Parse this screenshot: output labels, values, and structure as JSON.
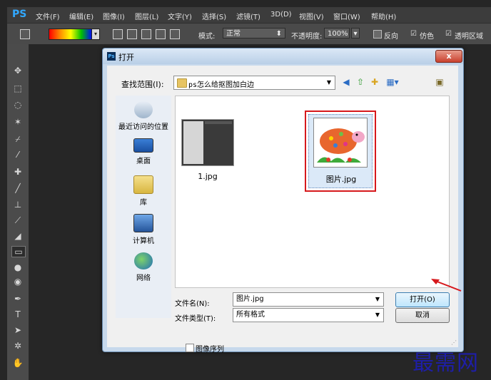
{
  "app": {
    "logo": "PS",
    "menu": [
      "文件(F)",
      "编辑(E)",
      "图像(I)",
      "图层(L)",
      "文字(Y)",
      "选择(S)",
      "滤镜(T)",
      "3D(D)",
      "视图(V)",
      "窗口(W)",
      "帮助(H)"
    ]
  },
  "options_bar": {
    "mode_label": "模式:",
    "mode_value": "正常",
    "opacity_label": "不透明度:",
    "opacity_value": "100%",
    "reverse_label": "反向",
    "dither_label": "仿色",
    "transparency_label": "透明区域"
  },
  "dialog": {
    "title": "打开",
    "app_icon": "Ps",
    "close": "x",
    "look_in_label": "查找范围(I):",
    "look_in_value": "ps怎么给抠图加白边",
    "places": [
      {
        "label": "最近访问的位置",
        "icon": "recent-places-icon"
      },
      {
        "label": "桌面",
        "icon": "desktop-icon"
      },
      {
        "label": "库",
        "icon": "library-icon"
      },
      {
        "label": "计算机",
        "icon": "computer-icon"
      },
      {
        "label": "网络",
        "icon": "network-icon"
      }
    ],
    "files": [
      {
        "name": "1.jpg",
        "selected": false
      },
      {
        "name": "图片.jpg",
        "selected": true
      }
    ],
    "filename_label": "文件名(N):",
    "filename_value": "图片.jpg",
    "filetype_label": "文件类型(T):",
    "filetype_value": "所有格式",
    "open_button": "打开(O)",
    "cancel_button": "取消",
    "sequence_label": "图像序列"
  },
  "colors": {
    "highlight_red": "#d6181c",
    "watermark": "#1e1ea8"
  },
  "watermark": "最需网"
}
